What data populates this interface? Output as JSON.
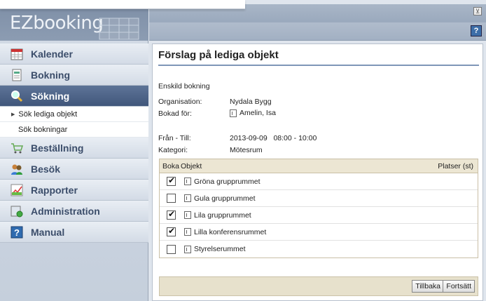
{
  "app": {
    "logo_text": "EZbooking"
  },
  "sidebar": {
    "items": [
      {
        "label": "Kalender"
      },
      {
        "label": "Bokning"
      },
      {
        "label": "Sökning"
      },
      {
        "label": "Beställning"
      },
      {
        "label": "Besök"
      },
      {
        "label": "Rapporter"
      },
      {
        "label": "Administration"
      },
      {
        "label": "Manual"
      }
    ],
    "sub_items": [
      {
        "label": "Sök lediga objekt"
      },
      {
        "label": "Sök bokningar"
      }
    ]
  },
  "header": {
    "help_label": "?",
    "pin_label": "⊻"
  },
  "main": {
    "title": "Förslag på lediga objekt",
    "booking_type": "Enskild bokning",
    "fields": {
      "organisation_label": "Organisation:",
      "organisation_value": "Nydala Bygg",
      "booked_for_label": "Bokad för:",
      "booked_for_value": "Amelin, Isa",
      "from_to_label": "Från - Till:",
      "from_to_value": "2013-09-09   08:00 - 10:00",
      "category_label": "Kategori:",
      "category_value": "Mötesrum"
    },
    "table": {
      "headers": [
        "Boka",
        "Objekt",
        "Platser (st)"
      ],
      "rows": [
        {
          "checked": true,
          "name": "Gröna grupprummet"
        },
        {
          "checked": false,
          "name": "Gula grupprummet"
        },
        {
          "checked": true,
          "name": "Lila grupprummet"
        },
        {
          "checked": true,
          "name": "Lilla konferensrummet"
        },
        {
          "checked": false,
          "name": "Styrelserummet"
        }
      ]
    },
    "buttons": {
      "back": "Tillbaka",
      "continue": "Fortsätt"
    }
  }
}
